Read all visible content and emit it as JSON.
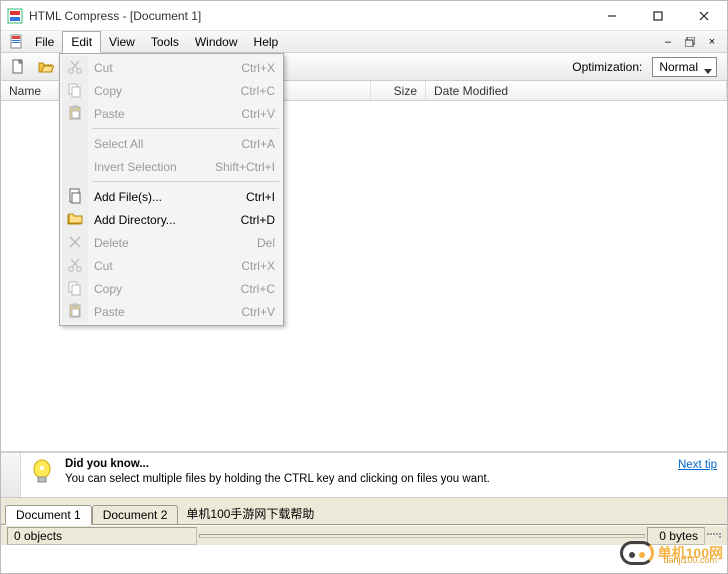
{
  "window": {
    "title": "HTML Compress - [Document 1]"
  },
  "menu": {
    "items": [
      "File",
      "Edit",
      "View",
      "Tools",
      "Window",
      "Help"
    ],
    "active_index": 1
  },
  "edit_menu": [
    {
      "type": "item",
      "label": "Cut",
      "shortcut": "Ctrl+X",
      "icon": "scissors-icon",
      "enabled": false
    },
    {
      "type": "item",
      "label": "Copy",
      "shortcut": "Ctrl+C",
      "icon": "copy-icon",
      "enabled": false
    },
    {
      "type": "item",
      "label": "Paste",
      "shortcut": "Ctrl+V",
      "icon": "paste-icon",
      "enabled": false
    },
    {
      "type": "sep"
    },
    {
      "type": "item",
      "label": "Select All",
      "shortcut": "Ctrl+A",
      "enabled": false
    },
    {
      "type": "item",
      "label": "Invert Selection",
      "shortcut": "Shift+Ctrl+I",
      "enabled": false
    },
    {
      "type": "sep"
    },
    {
      "type": "item",
      "label": "Add File(s)...",
      "shortcut": "Ctrl+I",
      "icon": "add-file-icon",
      "enabled": true
    },
    {
      "type": "item",
      "label": "Add Directory...",
      "shortcut": "Ctrl+D",
      "icon": "add-folder-icon",
      "enabled": true
    },
    {
      "type": "item",
      "label": "Delete",
      "shortcut": "Del",
      "icon": "delete-icon",
      "enabled": false
    },
    {
      "type": "item",
      "label": "Cut",
      "shortcut": "Ctrl+X",
      "icon": "scissors-icon",
      "enabled": false
    },
    {
      "type": "item",
      "label": "Copy",
      "shortcut": "Ctrl+C",
      "icon": "copy-icon",
      "enabled": false
    },
    {
      "type": "item",
      "label": "Paste",
      "shortcut": "Ctrl+V",
      "icon": "paste-icon",
      "enabled": false
    }
  ],
  "toolbar": {
    "optimization_label": "Optimization:",
    "optimization_value": "Normal"
  },
  "columns": {
    "name": "Name",
    "size": "Size",
    "date": "Date Modified"
  },
  "tip": {
    "heading": "Did you know...",
    "body": "You can select multiple files by holding the CTRL key and clicking on files you want.",
    "link": "Next tip"
  },
  "tabs": {
    "items": [
      "Document 1",
      "Document 2"
    ],
    "extra": "单机100手游网下载帮助",
    "active_index": 0
  },
  "status": {
    "objects": "0 objects",
    "bytes": "0 bytes"
  },
  "watermark": {
    "brand": "单机100网",
    "url": "danji100.com"
  }
}
